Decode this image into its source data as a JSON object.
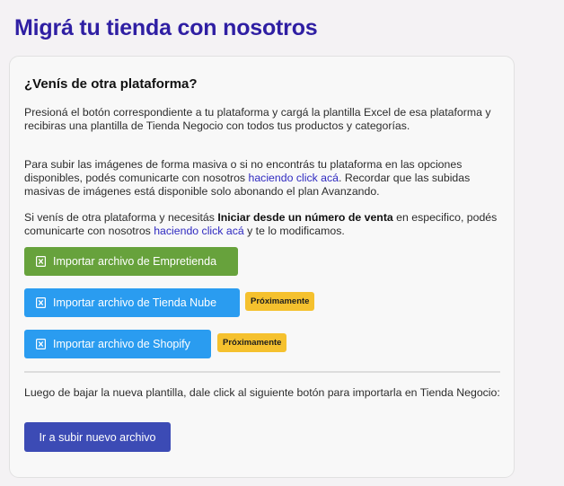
{
  "page": {
    "title": "Migrá tu tienda con nosotros"
  },
  "card": {
    "heading": "¿Venís de otra plataforma?",
    "paragraph1": "Presioná el botón correspondiente a tu plataforma y cargá la plantilla Excel de esa plataforma y recibiras una plantilla de Tienda Negocio con todos tus productos y categorías.",
    "paragraph2": {
      "before_link": "Para subir las imágenes de forma masiva o si no encontrás tu plataforma en las opciones disponibles, podés comunicarte con nosotros ",
      "link": "haciendo click acá",
      "after_link": ". Recordar que las subidas masivas de imágenes está disponible solo abonando el plan Avanzando."
    },
    "paragraph3": {
      "before_bold": "Si venís de otra plataforma y necesitás ",
      "bold": "Iniciar desde un número de venta",
      "middle": " en especifico, podés comunicarte con nosotros ",
      "link": "haciendo click acá",
      "after_link": " y te lo modificamos."
    },
    "import_buttons": [
      {
        "label": "Importar archivo de Empretienda",
        "color": "#67a23c",
        "badge": ""
      },
      {
        "label": "Importar archivo de Tienda Nube",
        "color": "#2a9cf0",
        "badge": "Próximamente"
      },
      {
        "label": "Importar archivo de Shopify",
        "color": "#2a9cf0",
        "badge": "Próximamente"
      }
    ],
    "paragraph4": "Luego de bajar la nueva plantilla, dale click al siguiente botón para importarla en Tienda Negocio:",
    "submit_button": "Ir a subir nuevo archivo",
    "icons": {
      "import": "excel-file-icon"
    },
    "colors": {
      "title": "#2f1fa3",
      "link": "#2f2ac0",
      "badge": "#f5c12e",
      "submit": "#3c4bb5"
    }
  }
}
